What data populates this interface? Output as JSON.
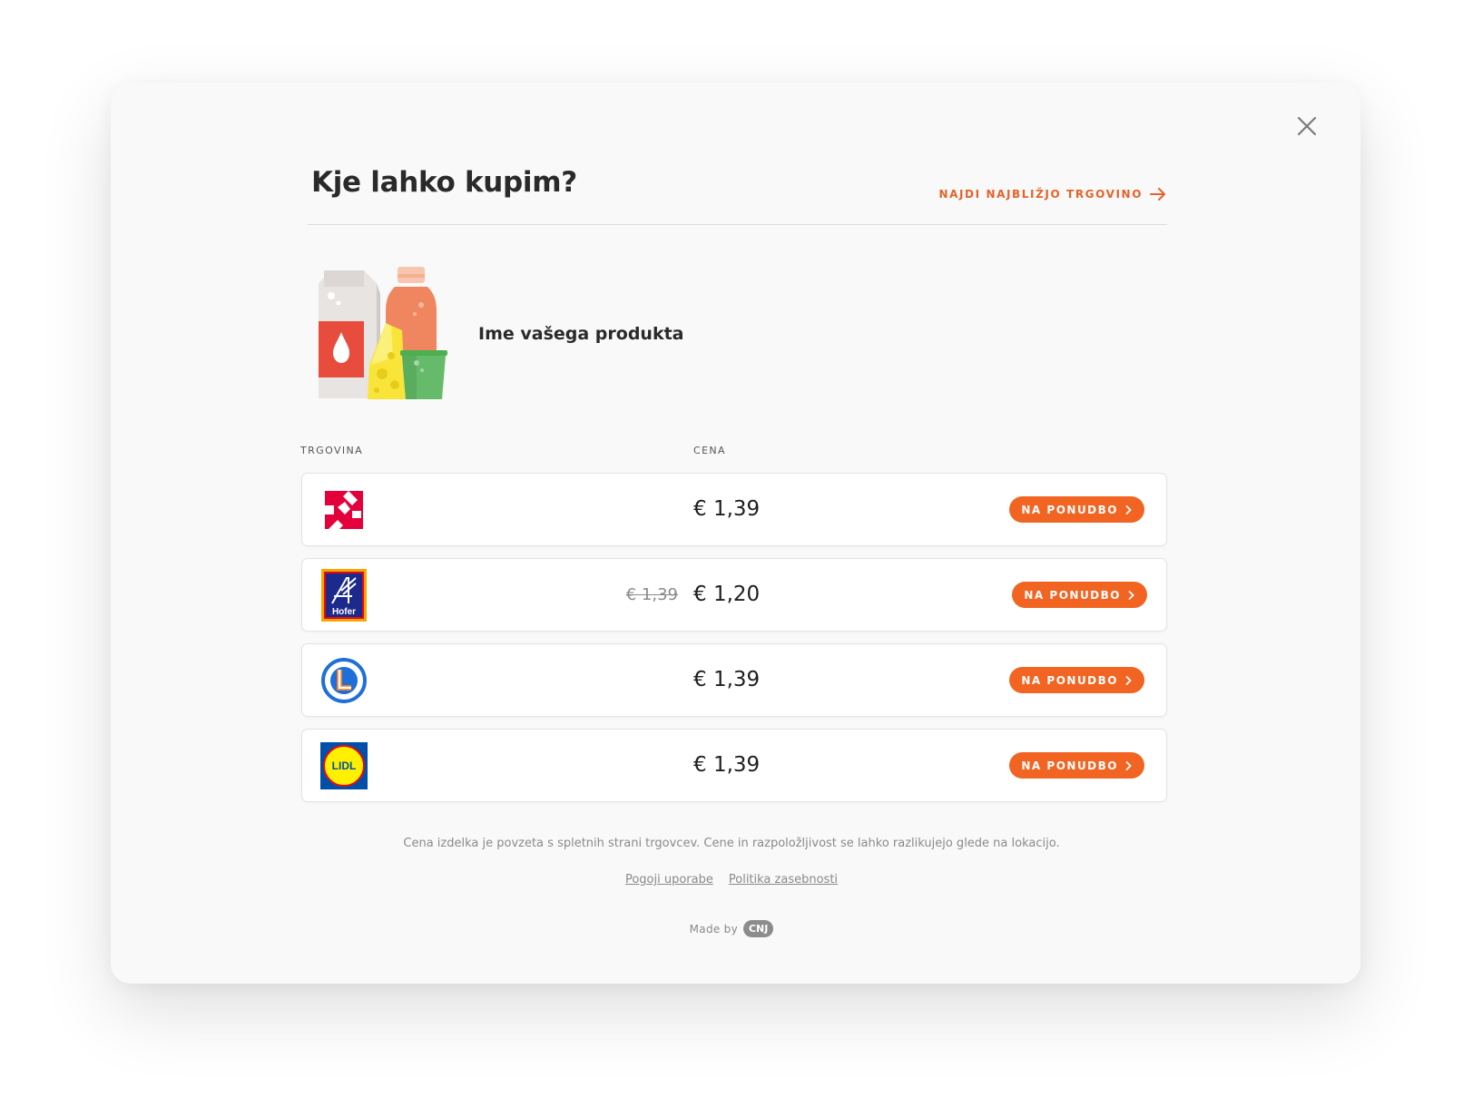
{
  "dialog": {
    "title": "Kje lahko kupim?",
    "find_store_label": "NAJDI NAJBLIŽJO TRGOVINO",
    "product_name": "Ime vašega produkta"
  },
  "table": {
    "col_store": "TRGOVINA",
    "col_price": "CENA",
    "rows": [
      {
        "store_logo": "spar-style-logo",
        "price": "€ 1,39",
        "old_price": "",
        "button": "NA PONUDBO"
      },
      {
        "store_logo": "hofer-logo",
        "logo_text": "Hofer",
        "price": "€ 1,20",
        "old_price": "€ 1,39",
        "button": "NA PONUDBO"
      },
      {
        "store_logo": "leclerc-logo",
        "price": "€ 1,39",
        "old_price": "",
        "button": "NA PONUDBO"
      },
      {
        "store_logo": "lidl-logo",
        "logo_text": "LIDL",
        "price": "€ 1,39",
        "old_price": "",
        "button": "NA PONUDBO"
      }
    ]
  },
  "footer": {
    "disclaimer": "Cena izdelka je povzeta s spletnih strani trgovcev. Cene in razpoložljivost se lahko razlikujejo glede na lokacijo.",
    "terms": "Pogoji uporabe",
    "privacy": "Politika zasebnosti",
    "made_by": "Made by",
    "brand": "CNJ"
  },
  "colors": {
    "accent": "#f26422",
    "link": "#e5622a"
  }
}
